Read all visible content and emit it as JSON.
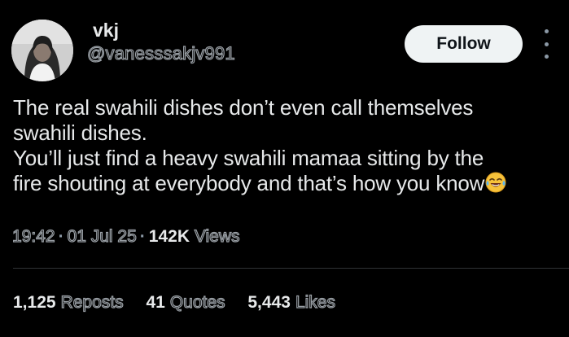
{
  "author": {
    "display_name": "vkj",
    "handle": "@vanesssakjv991"
  },
  "header": {
    "follow_label": "Follow",
    "more_icon": "more-vertical-icon"
  },
  "tweet": {
    "lines": [
      "The real swahili dishes don’t even call themselves",
      "swahili dishes.",
      "You’ll just find a heavy swahili mamaa sitting by the",
      "fire shouting at everybody and that’s how you know"
    ],
    "emoji": "😂",
    "emoji_icon": "face-with-tears-of-joy-icon"
  },
  "meta": {
    "time": "19:42",
    "separator": "·",
    "date": "01 Jul 25",
    "views_count": "142K",
    "views_label": "Views"
  },
  "stats": {
    "reposts_count": "1,125",
    "reposts_label": "Reposts",
    "quotes_count": "41",
    "quotes_label": "Quotes",
    "likes_count": "5,443",
    "likes_label": "Likes"
  },
  "colors": {
    "background": "#000000",
    "text_primary": "#e7e9ea",
    "text_secondary": "#9aa0a6",
    "follow_bg": "#eff3f4",
    "divider": "#2f3336"
  }
}
